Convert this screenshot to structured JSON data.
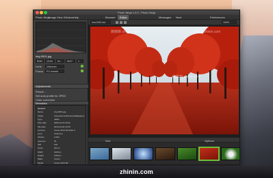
{
  "window": {
    "title": "Photo Ninja 1.4.0 - Photo Ninja",
    "menu": [
      "Photo Ninja",
      "Image",
      "View",
      "Window",
      "Help"
    ],
    "modes": [
      "Browser",
      "Editor",
      "Messages",
      "Next"
    ],
    "active_mode": "Editor",
    "right_label": "Preferences"
  },
  "viewer": {
    "file_label": "img-0001.jpg",
    "zoom": "100%",
    "watermarks": [
      "節節節 zhinin.com",
      "節節節 zhinin.com",
      "節節節 zhinin.com"
    ]
  },
  "left_panel": {
    "file_name": "img-0001.jpg",
    "info_rows": [
      [
        "RGB",
        "1/100",
        "f/4",
        "ISO7",
        "1"
      ],
      [
        "Lens",
        "Unknown"
      ],
      [
        "Focus",
        "F/1 (pixels)"
      ]
    ],
    "adjustments_head": "Adjustments",
    "adjust_rows": [
      "Preset...",
      "Set auto profile for JPEG",
      "Color correction"
    ],
    "metadata_head": "Metadata",
    "metadata": [
      [
        "General",
        ""
      ],
      [
        "Name",
        "img-0001.jpg"
      ],
      [
        "Folder",
        "/Users/demo/Pictures/Wallpapers"
      ],
      [
        "Type",
        "JPEG"
      ],
      [
        "Shot date",
        "2009-10-15 09:32"
      ],
      [
        "File date",
        "2013-04-03 10:45"
      ],
      [
        "Camera",
        "Canon EOS 5D Mark II"
      ],
      [
        "Lens",
        "Unknown"
      ],
      [
        "Shutter",
        "1/100"
      ],
      [
        "Aperture",
        "f/4"
      ],
      [
        "ISO",
        "100"
      ],
      [
        "Focal",
        "24mm"
      ],
      [
        "Width",
        "1920 px"
      ],
      [
        "Height",
        "1200 px"
      ],
      [
        "Make",
        "Canon"
      ],
      [
        "Model",
        "Canon EOS 5D"
      ]
    ]
  },
  "filmstrip": {
    "label_left": "Sort",
    "label_right": "Options"
  },
  "footer": "zhinin.com",
  "colors": {
    "accent": "#6fbf3a",
    "window_bg": "#2b2b2b",
    "panel_bg": "#3c3c3c"
  }
}
